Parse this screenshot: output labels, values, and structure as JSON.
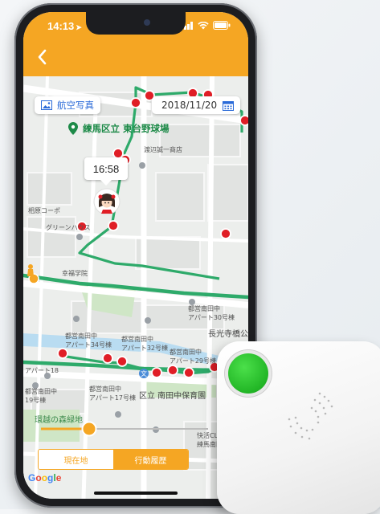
{
  "status_bar": {
    "time": "14:13",
    "location_arrow": "➤"
  },
  "header": {
    "back_icon": "chevron-left-icon"
  },
  "map": {
    "aerial_button_label": "航空写真",
    "date_label": "2018/11/20",
    "place_name": "練馬区立 東台野球場",
    "time_bubble": "16:58",
    "labels": {
      "watanabe": "渡辺誠一商店",
      "sagami": "相原コーポ",
      "green_house": "グリーンハウス",
      "kofuku": "幸福学院",
      "toei30": "都営南田中\nアパート30号棟",
      "chokoji": "長光寺橋公",
      "toei34": "都営南田中\nアパート34号棟",
      "toei32": "都営南田中\nアパート32号棟",
      "toei29": "都営南田中\nアパート29号棟",
      "toei18": "アパート18",
      "nursery": "区立 南田中保育園",
      "toei17": "都営南田中\nアパート17号棟",
      "toei19": "都営南田中\n19号棟",
      "forest": "環越の森緑地",
      "kaisoku": "快活CL\n練馬南田"
    },
    "google_logo": "Google"
  },
  "mode_toggle": {
    "current_location": "現在地",
    "history": "行動履歴",
    "selected": "history"
  },
  "colors": {
    "accent": "#f5a623",
    "route": "#2eaa6a",
    "pin": "#e01e26",
    "device_button": "#22b626"
  }
}
